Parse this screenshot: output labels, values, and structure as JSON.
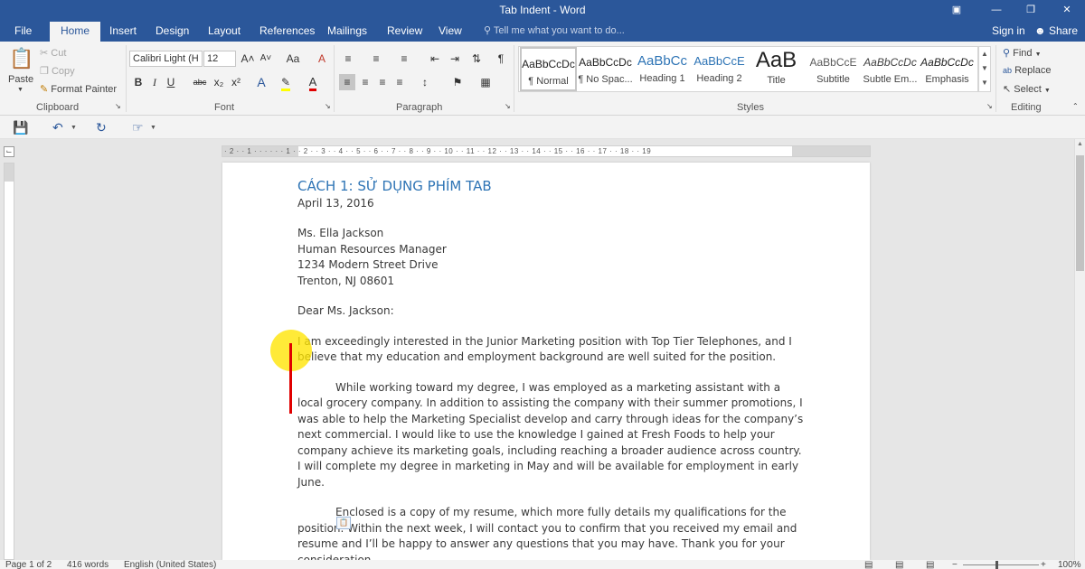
{
  "window": {
    "title": "Tab Indent - Word"
  },
  "tabs": [
    "File",
    "Home",
    "Insert",
    "Design",
    "Layout",
    "References",
    "Mailings",
    "Review",
    "View"
  ],
  "tell_me": "Tell me what you want to do...",
  "account": {
    "sign_in": "Sign in",
    "share": "Share"
  },
  "clipboard": {
    "paste": "Paste",
    "cut": "Cut",
    "copy": "Copy",
    "format_painter": "Format Painter",
    "label": "Clipboard"
  },
  "font": {
    "name": "Calibri Light (H",
    "size": "12",
    "label": "Font",
    "bold": "B",
    "italic": "I",
    "underline": "U",
    "strike": "abc",
    "sub": "x₂",
    "sup": "x²",
    "grow": "A˄",
    "shrink": "A˅",
    "case": "Aa",
    "clear": "A"
  },
  "paragraph": {
    "label": "Paragraph",
    "pilcrow": "¶"
  },
  "styles": {
    "label": "Styles",
    "items": [
      {
        "preview": "AaBbCcDc",
        "name": "¶ Normal"
      },
      {
        "preview": "AaBbCcDc",
        "name": "¶ No Spac..."
      },
      {
        "preview": "AaBbCc",
        "name": "Heading 1"
      },
      {
        "preview": "AaBbCcE",
        "name": "Heading 2"
      },
      {
        "preview": "AaB",
        "name": "Title"
      },
      {
        "preview": "AaBbCcE",
        "name": "Subtitle"
      },
      {
        "preview": "AaBbCcDc",
        "name": "Subtle Em..."
      },
      {
        "preview": "AaBbCcDc",
        "name": "Emphasis"
      }
    ]
  },
  "editing": {
    "find": "Find",
    "replace": "Replace",
    "select": "Select",
    "label": "Editing"
  },
  "ruler": {
    "numbers": "· 2 · · 1 · · · · · · 1 · · 2 · · 3 · · 4 · · 5 · · 6 · · 7 · · 8 · · 9 · · 10 · · 11 · · 12 · · 13 · · 14 · · 15 · · 16 · · 17 · · 18 · · 19"
  },
  "document": {
    "heading": "CÁCH 1: SỬ DỤNG PHÍM TAB",
    "date": "April 13, 2016",
    "address": [
      "Ms. Ella Jackson",
      "Human Resources Manager",
      "1234 Modern Street Drive",
      "Trenton, NJ 08601"
    ],
    "greeting": "Dear Ms. Jackson:",
    "para1": "I am exceedingly interested in the Junior Marketing position with Top Tier Telephones, and I believe that my education and employment background are well suited for the position.",
    "para2": "While working toward my degree, I was employed as a marketing assistant with a local grocery company. In addition to assisting the company with their summer promotions, I was able to help the Marketing Specialist develop and carry through ideas for the company’s next commercial. I would like to use the knowledge I gained at Fresh Foods to help your company achieve its marketing goals, including reaching a broader audience across country. I will complete my degree in marketing in May and will be available for employment in early June.",
    "para3": "Enclosed is a copy of my resume, which more fully details my qualifications for the position. Within the next week, I will contact you to confirm that you received my email and resume and I’ll be happy to answer any questions that you may have. Thank you for your consideration."
  },
  "status": {
    "page": "Page 1 of 2",
    "words": "416 words",
    "language": "English (United States)",
    "zoom": "100%"
  }
}
